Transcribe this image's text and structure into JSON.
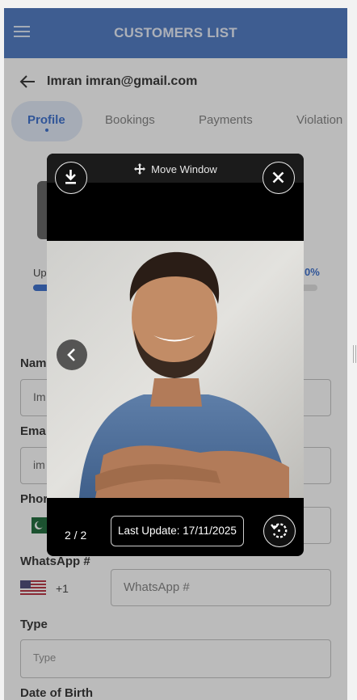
{
  "app": {
    "title": "CUSTOMERS LIST"
  },
  "customer": {
    "title": "Imran imran@gmail.com"
  },
  "tabs": [
    {
      "label": "Profile"
    },
    {
      "label": "Bookings"
    },
    {
      "label": "Payments"
    },
    {
      "label": "Violation"
    }
  ],
  "profile": {
    "progress_label": "Up",
    "progress_pct_text": "0%",
    "progress_fraction": 0.07
  },
  "form": {
    "name": {
      "label": "Nam",
      "value": "Im"
    },
    "email": {
      "label": "Ema",
      "value": "im"
    },
    "phone": {
      "label": "Phor"
    },
    "whatsapp": {
      "label": "WhatsApp #",
      "dial_code": "+1",
      "placeholder": "WhatsApp #"
    },
    "type": {
      "label": "Type",
      "placeholder": "Type"
    },
    "dob": {
      "label": "Date of Birth"
    }
  },
  "viewer": {
    "move_label": "Move Window",
    "page_indicator": "2 / 2",
    "last_update": "Last Update: 17/11/2025"
  },
  "colors": {
    "brand_bar": "#3f6fbf",
    "accent": "#2a63c9",
    "overlay": "rgba(60,60,60,0.35)"
  },
  "icons": [
    "menu-icon",
    "back-arrow-icon",
    "download-icon",
    "move-icon",
    "close-icon",
    "chevron-left-icon",
    "rotate-icon",
    "pakistan-flag-icon",
    "us-flag-icon"
  ]
}
